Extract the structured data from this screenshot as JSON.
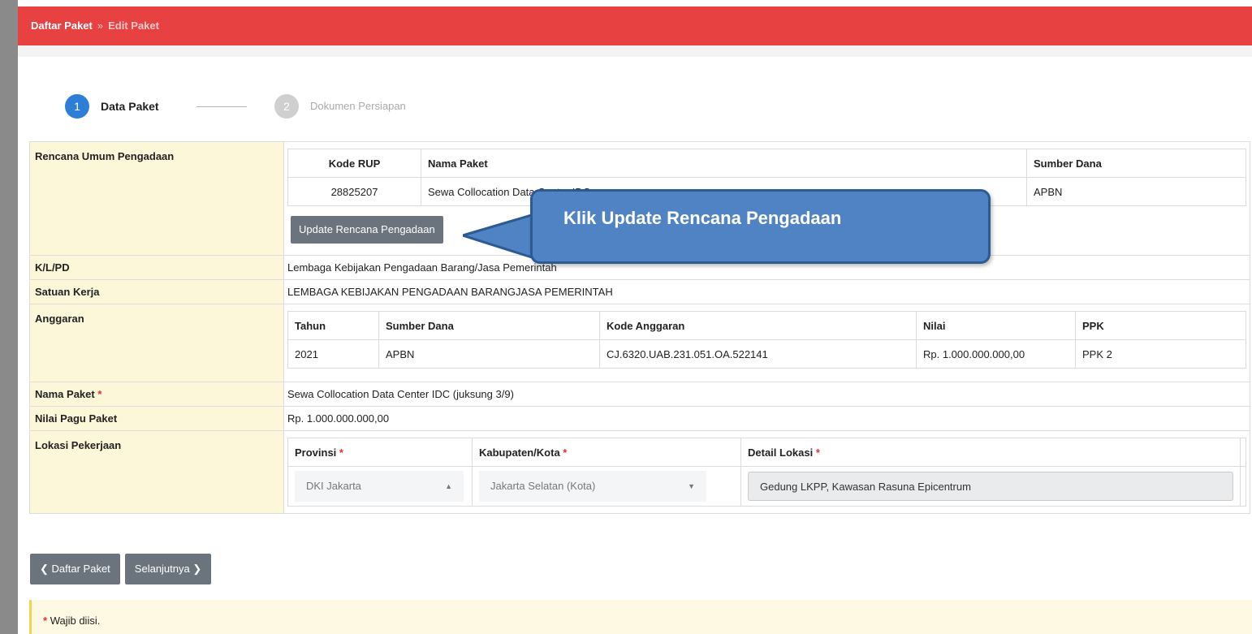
{
  "breadcrumb": {
    "root": "Daftar Paket",
    "separator": "»",
    "current": "Edit Paket"
  },
  "wizard": {
    "steps": [
      {
        "num": "1",
        "label": "Data Paket",
        "active": true
      },
      {
        "num": "2",
        "label": "Dokumen Persiapan",
        "active": false
      }
    ]
  },
  "form": {
    "rup": {
      "label": "Rencana Umum Pengadaan",
      "headers": [
        "Kode RUP",
        "Nama Paket",
        "Sumber Dana"
      ],
      "row": [
        "28825207",
        "Sewa Collocation Data Center IDC",
        "APBN"
      ],
      "update_button": "Update Rencana Pengadaan"
    },
    "klpd": {
      "label": "K/L/PD",
      "value": "Lembaga Kebijakan Pengadaan Barang/Jasa Pemerintah"
    },
    "satker": {
      "label": "Satuan Kerja",
      "value": "LEMBAGA KEBIJAKAN PENGADAAN BARANGJASA PEMERINTAH"
    },
    "anggaran": {
      "label": "Anggaran",
      "headers": [
        "Tahun",
        "Sumber Dana",
        "Kode Anggaran",
        "Nilai",
        "PPK"
      ],
      "row": [
        "2021",
        "APBN",
        "CJ.6320.UAB.231.051.OA.522141",
        "Rp. 1.000.000.000,00",
        "PPK 2"
      ]
    },
    "nama_paket": {
      "label": "Nama Paket",
      "value": "Sewa Collocation Data Center IDC (juksung 3/9)"
    },
    "nilai_pagu": {
      "label": "Nilai Pagu Paket",
      "value": "Rp. 1.000.000.000,00"
    },
    "lokasi": {
      "label": "Lokasi Pekerjaan",
      "headers": [
        "Provinsi",
        "Kabupaten/Kota",
        "Detail Lokasi"
      ],
      "provinsi": "DKI Jakarta",
      "kabupaten": "Jakarta Selatan (Kota)",
      "detail": "Gedung LKPP, Kawasan Rasuna Epicentrum"
    },
    "required_mark": "*"
  },
  "buttons": {
    "back": "Daftar Paket",
    "next": "Selanjutnya"
  },
  "note": {
    "text": "Wajib diisi."
  },
  "callout": {
    "text": "Klik Update Rencana Pengadaan"
  },
  "colors": {
    "header": "#e84142",
    "accent": "#2c7ed6",
    "label_bg": "#fbf7d8",
    "button": "#6b747c",
    "callout": "#4f83c4"
  }
}
